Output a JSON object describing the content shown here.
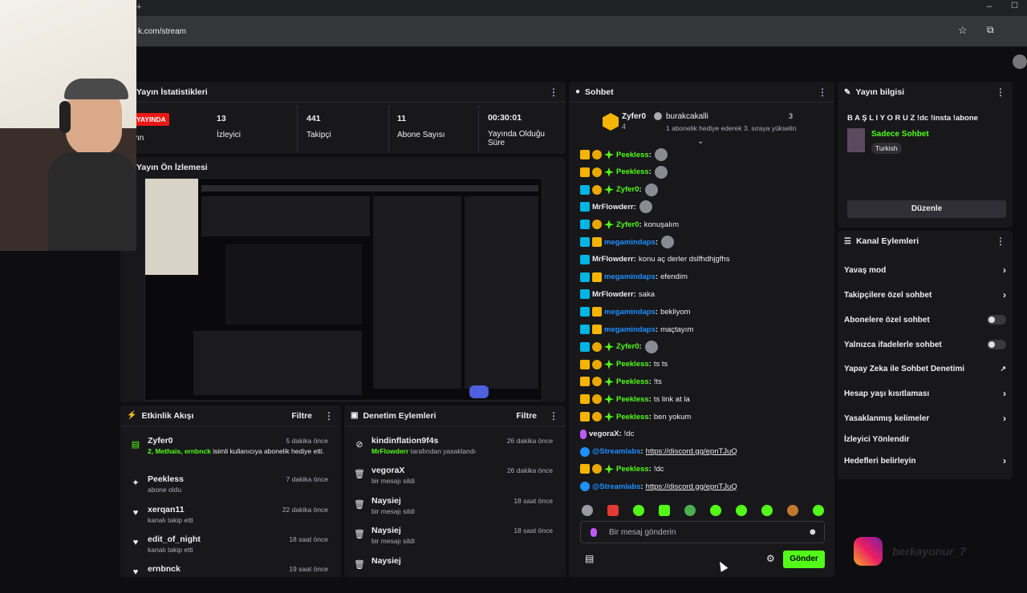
{
  "browser": {
    "url": "k.com/stream"
  },
  "stats": {
    "title": "Yayın İstatistikleri",
    "live_label": "YAYINDA",
    "live_sub": "yın",
    "items": [
      {
        "value": "13",
        "label": "İzleyici"
      },
      {
        "value": "441",
        "label": "Takipçi"
      },
      {
        "value": "11",
        "label": "Abone Sayısı"
      },
      {
        "value": "00:30:01",
        "label": "Yayında Olduğu Süre"
      }
    ]
  },
  "preview": {
    "title": "Yayın Ön İzlemesi"
  },
  "activity": {
    "title": "Etkinlik Akışı",
    "filter": "Filtre",
    "items": [
      {
        "name": "Zyfer0",
        "desc_names": "2, Methais, ernbnck",
        "desc": "isimli kullanıcıya abonelik hediye etti.",
        "time": "5 dakika önce",
        "icon": "gift-icon"
      },
      {
        "name": "Peekless",
        "desc": "abone oldu",
        "time": "7 dakika önce",
        "icon": "star-icon"
      },
      {
        "name": "xerqan11",
        "desc": "kanalı takip etti",
        "time": "22 dakika önce",
        "icon": "heart-icon"
      },
      {
        "name": "edit_of_night",
        "desc": "kanalı takip etti",
        "time": "18 saat önce",
        "icon": "heart-icon"
      },
      {
        "name": "ernbnck",
        "desc": "",
        "time": "19 saat önce",
        "icon": "heart-icon"
      }
    ]
  },
  "moderation": {
    "title": "Denetim Eylemleri",
    "filter": "Filtre",
    "items": [
      {
        "name": "kindinflation9f4s",
        "desc_user": "MrFlowderr",
        "desc": "tarafından yasaklandı",
        "time": "26 dakika önce",
        "icon": "ban-icon"
      },
      {
        "name": "vegoraX",
        "desc": "bir mesajı sildi",
        "time": "26 dakika önce",
        "icon": "trash-icon"
      },
      {
        "name": "Naysiej",
        "desc": "bir mesajı sildi",
        "time": "18 saat önce",
        "icon": "trash-icon"
      },
      {
        "name": "Naysiej",
        "desc": "bir mesajı sildi",
        "time": "18 saat önce",
        "icon": "trash-icon"
      },
      {
        "name": "Naysiej",
        "desc": "bir mesajı sildi",
        "time": "",
        "icon": "trash-icon"
      }
    ]
  },
  "chat": {
    "title": "Sohbet",
    "pinned": {
      "user": "Zyfer0",
      "count": "4",
      "gifter": "burakcakalli",
      "gift_count": "3",
      "text": "1 abonelik hediye ederek 3. sıraya yükselin"
    },
    "messages": [
      {
        "badges": [
          "crown",
          "coin",
          "star"
        ],
        "user": "Peekless",
        "color": "green",
        "text": "",
        "emote": true
      },
      {
        "badges": [
          "crown",
          "coin",
          "star"
        ],
        "user": "Peekless",
        "color": "green",
        "text": "",
        "emote": true
      },
      {
        "badges": [
          "mod",
          "coin",
          "star"
        ],
        "user": "Zyfer0",
        "color": "green",
        "text": "",
        "emote": true
      },
      {
        "badges": [
          "mod"
        ],
        "user": "MrFlowderr",
        "color": "plain",
        "text": "",
        "emote": true
      },
      {
        "badges": [
          "mod",
          "coin",
          "star"
        ],
        "user": "Zyfer0",
        "color": "green",
        "text": "konuşalım",
        "emote": false
      },
      {
        "badges": [
          "mod",
          "crown"
        ],
        "user": "megamindaps",
        "color": "blue",
        "text": "",
        "emote": true
      },
      {
        "badges": [
          "mod"
        ],
        "user": "MrFlowderr",
        "color": "plain",
        "text": "konu aç derler dslfhdhjgfhs",
        "emote": false
      },
      {
        "badges": [
          "mod",
          "crown"
        ],
        "user": "megamindaps",
        "color": "blue",
        "text": "efendim",
        "emote": false
      },
      {
        "badges": [
          "mod"
        ],
        "user": "MrFlowderr",
        "color": "plain",
        "text": "saka",
        "emote": false
      },
      {
        "badges": [
          "mod",
          "crown"
        ],
        "user": "megamindaps",
        "color": "blue",
        "text": "bekliyom",
        "emote": false
      },
      {
        "badges": [
          "mod",
          "crown"
        ],
        "user": "megamindaps",
        "color": "blue",
        "text": "maçtayım",
        "emote": false
      },
      {
        "badges": [
          "mod",
          "coin",
          "star"
        ],
        "user": "Zyfer0",
        "color": "green",
        "text": "",
        "emote": true
      },
      {
        "badges": [
          "crown",
          "coin",
          "star"
        ],
        "user": "Peekless",
        "color": "green",
        "text": "ts ts",
        "emote": false
      },
      {
        "badges": [
          "crown",
          "coin",
          "star"
        ],
        "user": "Peekless",
        "color": "green",
        "text": "!ts",
        "emote": false
      },
      {
        "badges": [
          "crown",
          "coin",
          "star"
        ],
        "user": "Peekless",
        "color": "green",
        "text": "ts link at la",
        "emote": false
      },
      {
        "badges": [
          "crown",
          "coin",
          "star"
        ],
        "user": "Peekless",
        "color": "green",
        "text": "ben yokum",
        "emote": false
      },
      {
        "badges": [
          "mic"
        ],
        "user": "vegoraX",
        "color": "plain",
        "text": "!dc",
        "emote": false
      },
      {
        "badges": [
          "bot"
        ],
        "user": "@Streamlabs",
        "color": "blue",
        "text": "",
        "link": "https://discord.gg/epnTJuQ",
        "emote": false
      },
      {
        "badges": [
          "crown",
          "coin",
          "star"
        ],
        "user": "Peekless",
        "color": "green",
        "text": "!dc",
        "emote": false
      },
      {
        "badges": [
          "bot"
        ],
        "user": "@Streamlabs",
        "color": "blue",
        "text": "",
        "link": "https://discord.gg/epnTJuQ",
        "emote": false
      }
    ],
    "input_placeholder": "Bir mesaj gönderin",
    "send_label": "Gönder"
  },
  "stream_info": {
    "title": "Yayın bilgisi",
    "stream_title": "B A Ş L I Y O R U Z !dc !insta !abone",
    "category": "Sadece Sohbet",
    "language": "Turkish",
    "edit_label": "Düzenle"
  },
  "channel_actions": {
    "title": "Kanal Eylemleri",
    "items": [
      {
        "label": "Yavaş mod",
        "control": "chevron"
      },
      {
        "label": "Takipçilere özel sohbet",
        "control": "chevron"
      },
      {
        "label": "Abonelere özel sohbet",
        "control": "toggle"
      },
      {
        "label": "Yalnızca ifadelerle sohbet",
        "control": "toggle"
      },
      {
        "label": "Yapay Zeka ile Sohbet Denetimi",
        "control": "external"
      },
      {
        "label": "Hesap yaşı kısıtlaması",
        "control": "chevron"
      },
      {
        "label": "Yasaklanmış kelimeler",
        "control": "chevron"
      },
      {
        "label": "İzleyici Yönlendir",
        "control": "none"
      },
      {
        "label": "Hedefleri belirleyin",
        "control": "chevron"
      }
    ]
  },
  "overlay": {
    "watermark": "berkayonur_7"
  }
}
